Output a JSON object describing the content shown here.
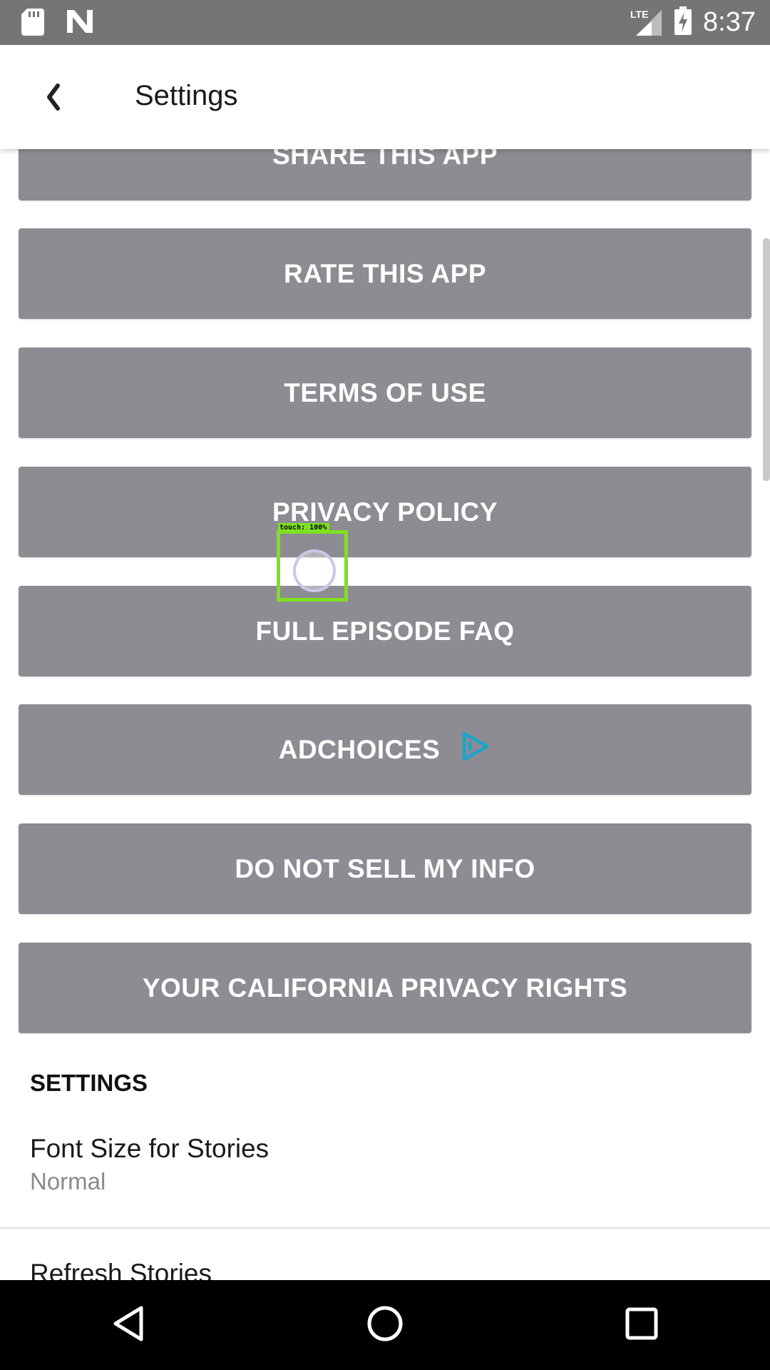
{
  "status_bar": {
    "time": "8:37",
    "network": "LTE",
    "icons": [
      "sd-card-icon",
      "n-logo-icon",
      "signal-icon",
      "battery-charging-icon"
    ]
  },
  "app_bar": {
    "title": "Settings",
    "back_icon": "back-chevron-icon"
  },
  "buttons": [
    {
      "label": "SHARE THIS APP"
    },
    {
      "label": "RATE THIS APP"
    },
    {
      "label": "TERMS OF USE"
    },
    {
      "label": "PRIVACY POLICY"
    },
    {
      "label": "FULL EPISODE FAQ"
    },
    {
      "label": "ADCHOICES",
      "icon": "adchoices-icon"
    },
    {
      "label": "DO NOT SELL MY INFO"
    },
    {
      "label": "YOUR CALIFORNIA PRIVACY RIGHTS"
    }
  ],
  "settings": {
    "header": "SETTINGS",
    "items": [
      {
        "title": "Font Size for Stories",
        "value": "Normal"
      },
      {
        "title": "Refresh Stories"
      }
    ]
  },
  "touch_overlay": {
    "label": "touch: 100%"
  },
  "colors": {
    "button_bg": "#8d8c92",
    "status_bar": "#757575",
    "adchoices_accent": "#1fa3c9",
    "touch_box": "#7fe020"
  }
}
